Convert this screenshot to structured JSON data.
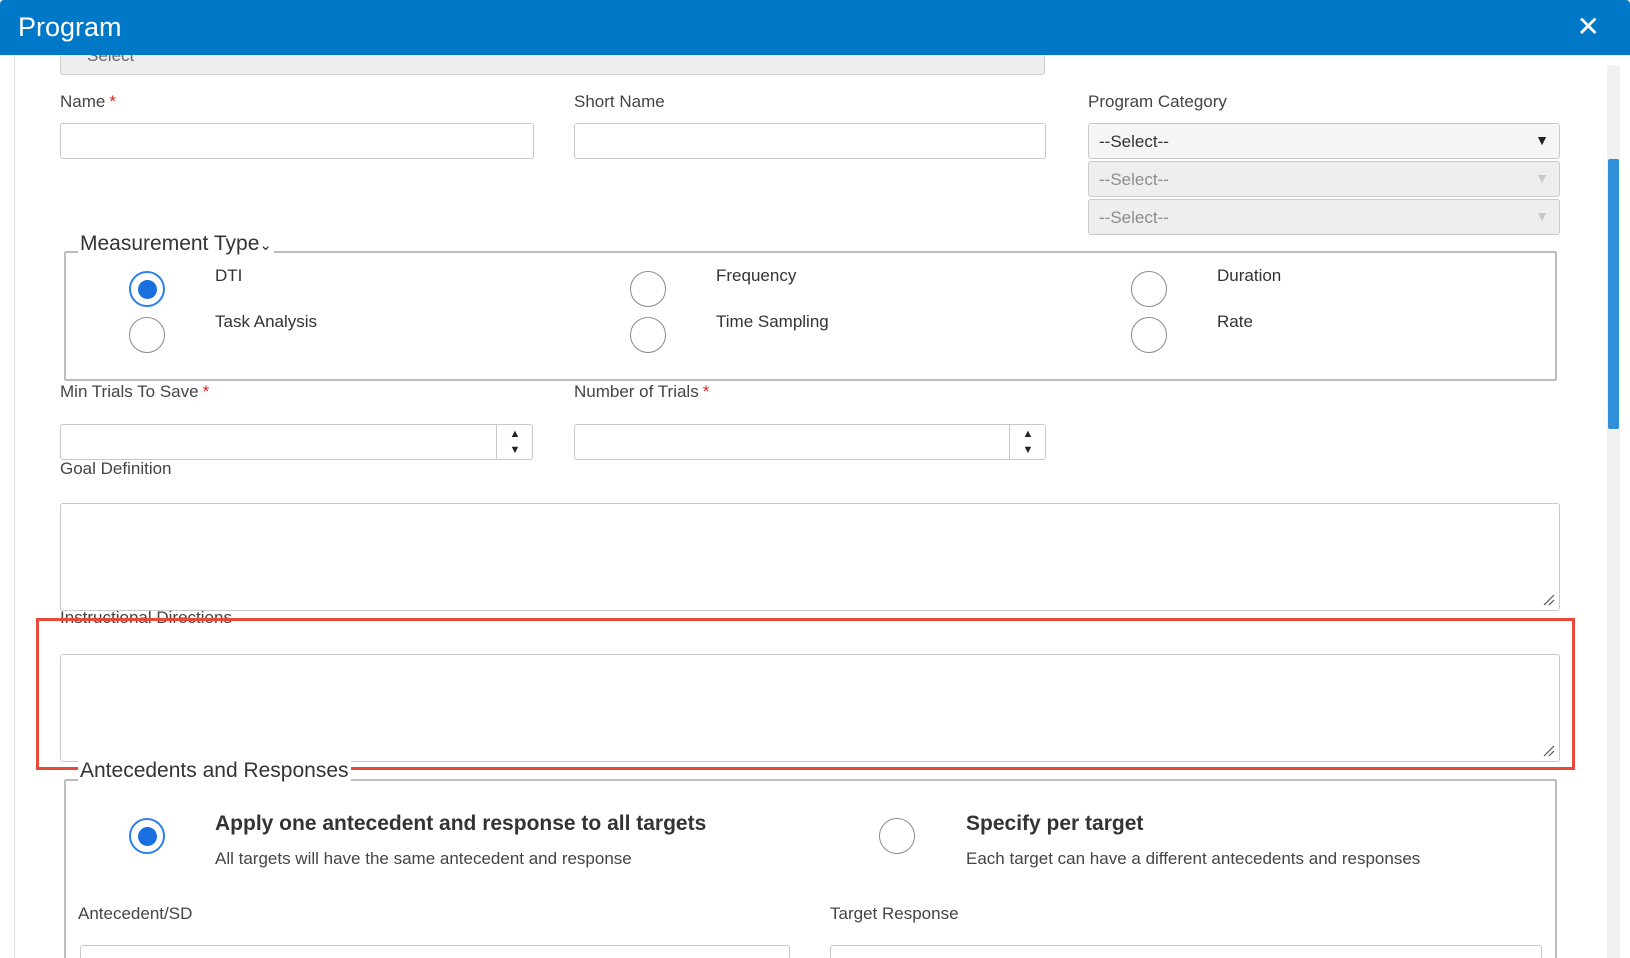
{
  "window": {
    "title": "Program",
    "close_icon": "close-icon"
  },
  "top_partial_select": {
    "value": "Select"
  },
  "fields": {
    "name": {
      "label": "Name",
      "required": "*",
      "value": ""
    },
    "short_name": {
      "label": "Short Name",
      "value": ""
    },
    "program_category": {
      "label": "Program Category",
      "select1": "--Select--",
      "select2": "--Select--",
      "select3": "--Select--"
    }
  },
  "measurement_type": {
    "legend": "Measurement Type",
    "chevron_icon": "chevron-down-icon",
    "options": [
      {
        "label": "DTI",
        "checked": true
      },
      {
        "label": "Frequency",
        "checked": false
      },
      {
        "label": "Duration",
        "checked": false
      },
      {
        "label": "Task Analysis",
        "checked": false
      },
      {
        "label": "Time Sampling",
        "checked": false
      },
      {
        "label": "Rate",
        "checked": false
      }
    ]
  },
  "min_trials": {
    "label": "Min Trials To Save",
    "required": "*",
    "value": ""
  },
  "number_of_trials": {
    "label": "Number of Trials",
    "required": "*",
    "value": ""
  },
  "goal_definition": {
    "label": "Goal Definition",
    "value": ""
  },
  "instructional_directions": {
    "label": "Instructional Directions",
    "value": ""
  },
  "antecedents": {
    "legend": "Antecedents and Responses",
    "option_all": {
      "title": "Apply one antecedent and response to all targets",
      "subtitle": "All targets will have the same antecedent and response",
      "checked": true
    },
    "option_per_target": {
      "title": "Specify per target",
      "subtitle": "Each target can have a different antecedents and responses",
      "checked": false
    },
    "antecedent_label": "Antecedent/SD",
    "target_response_label": "Target Response"
  },
  "colors": {
    "header": "#0078c8",
    "accent": "#1a6fe0",
    "required": "#e02424",
    "highlight": "#e84a3a"
  }
}
